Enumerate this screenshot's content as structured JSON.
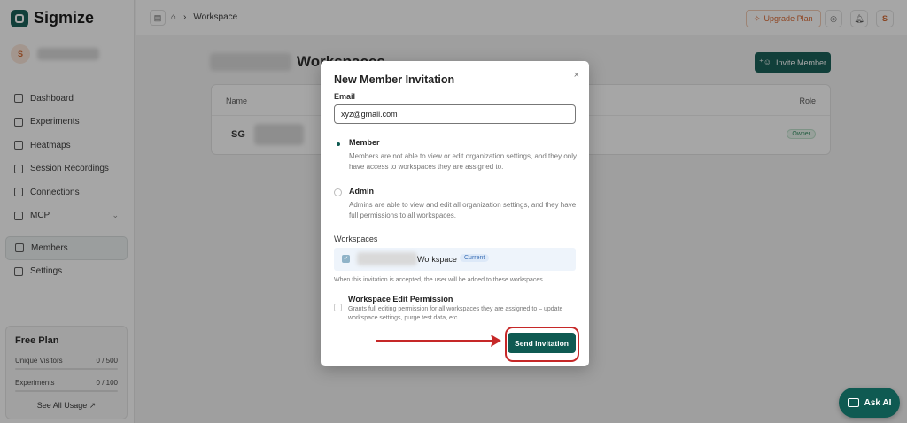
{
  "app": {
    "brand_name": "Sigmize",
    "brand_color": "#0f5a52"
  },
  "sidebar": {
    "user_initial": "S",
    "nav": [
      {
        "label": "Dashboard",
        "icon": "dashboard-icon"
      },
      {
        "label": "Experiments",
        "icon": "experiments-icon"
      },
      {
        "label": "Heatmaps",
        "icon": "heatmap-icon"
      },
      {
        "label": "Session Recordings",
        "icon": "video-icon"
      },
      {
        "label": "Connections",
        "icon": "connections-icon"
      },
      {
        "label": "MCP",
        "icon": "mcp-icon"
      },
      {
        "label": "Members",
        "icon": "users-icon"
      },
      {
        "label": "Settings",
        "icon": "gear-icon"
      }
    ],
    "plan": {
      "title": "Free Plan",
      "visitors_label": "Unique Visitors",
      "visitors_value": "0 / 500",
      "experiments_label": "Experiments",
      "experiments_value": "0 / 100",
      "see_all": "See All Usage ↗"
    }
  },
  "topbar": {
    "breadcrumb": "Workspace",
    "upgrade_label": "Upgrade Plan",
    "user_initial": "S"
  },
  "page": {
    "title": "Workspaces",
    "invite_button": "Invite Member",
    "table_headers": {
      "name": "Name",
      "role": "Role"
    },
    "row": {
      "initials": "SG",
      "role": "Owner"
    }
  },
  "modal": {
    "title": "New Member Invitation",
    "close": "×",
    "email_label": "Email",
    "email_value": "xyz@gmail.com",
    "roles": [
      {
        "title": "Member",
        "selected": true,
        "description": "Members are not able to view or edit organization settings, and they only have access to workspaces they are assigned to."
      },
      {
        "title": "Admin",
        "selected": false,
        "description": "Admins are able to view and edit all organization settings, and they have full permissions to all workspaces."
      }
    ],
    "workspaces_label": "Workspaces",
    "workspace_name": "Workspace",
    "workspace_badge": "Current",
    "workspace_checked": true,
    "workspace_note": "When this invitation is accepted, the user will be added to these workspaces.",
    "permission_title": "Workspace Edit Permission",
    "permission_desc": "Grants full editing permission for all workspaces they are assigned to – update workspace settings, purge test data, etc.",
    "permission_checked": false,
    "send_button": "Send Invitation"
  },
  "annotation": {
    "color": "#c62828"
  },
  "ask_ai": {
    "label": "Ask AI"
  }
}
